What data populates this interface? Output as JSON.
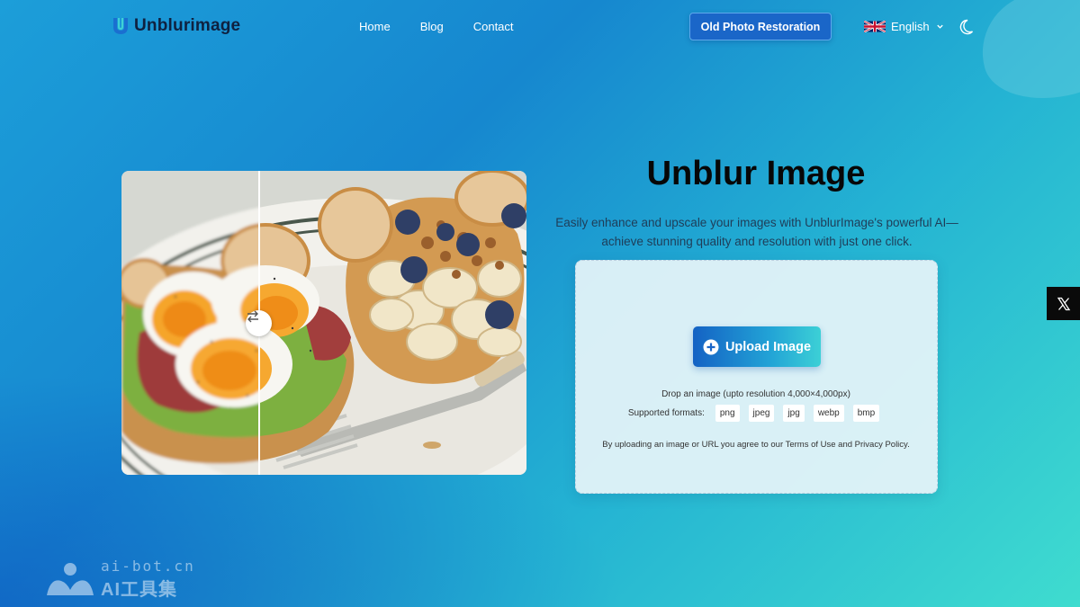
{
  "header": {
    "logo_text": "Unblurimage",
    "nav": [
      "Home",
      "Blog",
      "Contact"
    ],
    "restore_button": "Old Photo Restoration",
    "language": "English"
  },
  "hero": {
    "title": "Unblur Image",
    "subtitle": "Easily enhance and upscale your images with UnblurImage's powerful AI—achieve stunning quality and resolution with just one click."
  },
  "upload": {
    "button_label": "Upload Image",
    "drop_text": "Drop an image (upto resolution 4,000×4,000px)",
    "formats_label": "Supported formats:",
    "formats": [
      "png",
      "jpeg",
      "jpg",
      "webp",
      "bmp"
    ],
    "agree_text": "By uploading an image or URL you agree to our Terms of Use and Privacy Policy."
  },
  "watermark": {
    "top": "ai-bot.cn",
    "bottom": "AI工具集"
  },
  "icons": {
    "logo": "u-logo-icon",
    "flag": "uk-flag-icon",
    "chevron": "chevron-down-icon",
    "theme": "moon-icon",
    "slider": "swap-arrows-icon",
    "upload": "plus-circle-icon",
    "share": "x-logo-icon"
  },
  "colors": {
    "accent": "#1a66c8",
    "gradient_start": "#1687cf",
    "gradient_end": "#3fdccf"
  }
}
